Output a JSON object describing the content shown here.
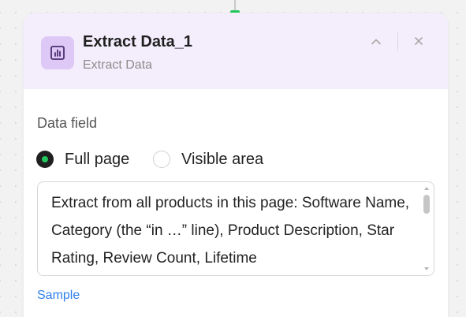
{
  "node": {
    "title": "Extract Data_1",
    "subtitle": "Extract Data",
    "icon": "bar-chart-icon",
    "accent_color": "#dec9f6",
    "header_bg": "#f4eefc"
  },
  "data_field": {
    "label": "Data field",
    "options": [
      {
        "label": "Full page",
        "selected": true
      },
      {
        "label": "Visible area",
        "selected": false
      }
    ]
  },
  "prompt": {
    "value": "Extract from all products in this page: Software Name, Category (the “in …” line), Product Description, Star Rating, Review Count, Lifetime"
  },
  "sample_link": "Sample",
  "colors": {
    "radio_selected_dot": "#22c55e",
    "link": "#2f80ed",
    "connector_dot": "#22c55e"
  }
}
